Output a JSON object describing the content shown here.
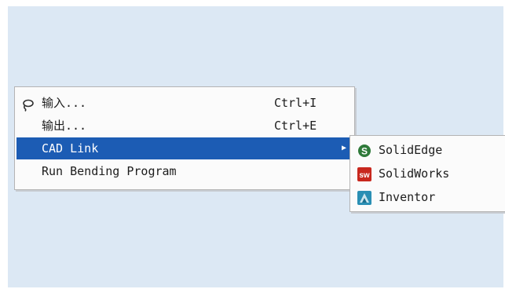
{
  "menu": {
    "items": [
      {
        "icon": "lasso-import-icon",
        "label": "输入...",
        "shortcut": "Ctrl+I"
      },
      {
        "label": "输出...",
        "shortcut": "Ctrl+E"
      },
      {
        "label": "CAD Link",
        "has_submenu": true,
        "highlighted": true
      },
      {
        "label": "Run Bending Program"
      }
    ]
  },
  "submenu": {
    "items": [
      {
        "icon": "solidedge-icon",
        "label": "SolidEdge"
      },
      {
        "icon": "solidworks-icon",
        "label": "SolidWorks"
      },
      {
        "icon": "inventor-icon",
        "label": "Inventor"
      }
    ]
  },
  "colors": {
    "highlight": "#1c5cb4",
    "background": "#dce8f4"
  }
}
